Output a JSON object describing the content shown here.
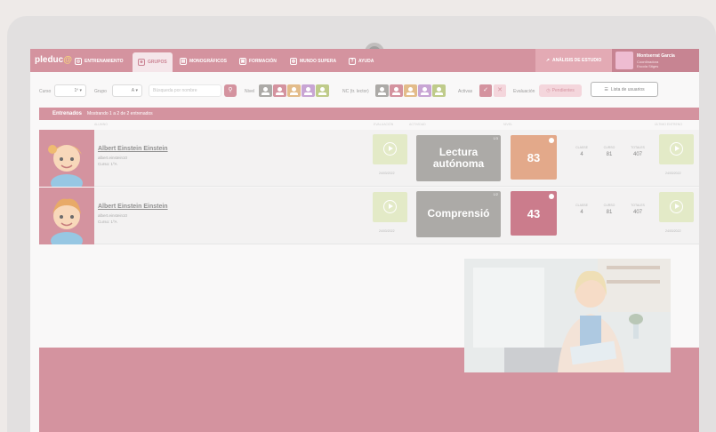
{
  "app": {
    "logo_text": "pleduc",
    "logo_dot": "@"
  },
  "nav": {
    "items": [
      {
        "label": "ENTRENAMIENTO"
      },
      {
        "label": "GRUPOS"
      },
      {
        "label": "MONOGRÁFICOS"
      },
      {
        "label": "FORMACIÓN"
      },
      {
        "label": "MUNDO SUPERA"
      },
      {
        "label": "AYUDA"
      }
    ],
    "active_index": 1,
    "analisis_label": "ANÁLISIS DE ESTUDIO"
  },
  "profile": {
    "name": "Montserrat García",
    "role": "Coordinadora",
    "school": "Escola Sitges"
  },
  "filters": {
    "curso_label": "Curso",
    "curso_value": "1º",
    "grupo_label": "Grupo",
    "grupo_value": "A",
    "search_placeholder": "Búsqueda por nombre",
    "nivel_label": "Nivel",
    "nc_label": "NC (tr. lector)",
    "activas_label": "Activas",
    "evaluacion_label": "Evaluación",
    "pendientes_label": "Pendientes",
    "lista_label": "Lista de usuarios"
  },
  "section": {
    "title": "Entrenados",
    "summary": "Mostrando 1 a 2 de 2 entrenados"
  },
  "col_headers": {
    "student": "ALUMNO",
    "eval": "EVALUACIÓN",
    "act": "ACTIVIDAD",
    "nc": "NIVEL",
    "last": "ÚLTIMO ENTRENO"
  },
  "students": [
    {
      "name": "Albert Einstein Einstein",
      "user": "albert.einstein10",
      "curso": "Curso: 1ºA",
      "eval_date": "24/03/2022",
      "activity": "Lectura autónoma",
      "activity_count": "1/3",
      "score": "83",
      "score_color": "#d9885e",
      "stats": [
        {
          "label": "CLASSE",
          "value": "4"
        },
        {
          "label": "CURSO",
          "value": "81"
        },
        {
          "label": "TOTALES",
          "value": "407"
        }
      ],
      "last_date": "24/03/2022"
    },
    {
      "name": "Albert Einstein Einstein",
      "user": "albert.einstein10",
      "curso": "Curso: 1ºA",
      "eval_date": "24/03/2022",
      "activity": "Comprensió",
      "activity_count": "1/2",
      "score": "43",
      "score_color": "#b84a60",
      "stats": [
        {
          "label": "CLASSE",
          "value": "4"
        },
        {
          "label": "CURSO",
          "value": "81"
        },
        {
          "label": "TOTALES",
          "value": "407"
        }
      ],
      "last_date": "24/03/2022"
    }
  ],
  "colors": {
    "brand": "#c46a7b",
    "nivel_chips": [
      "#8d8a85",
      "#c46a7b",
      "#d9a35e",
      "#b383c4",
      "#a7b85e"
    ],
    "nc_chips": [
      "#8d8a85",
      "#c46a7b",
      "#d9a35e",
      "#b383c4",
      "#a7b85e"
    ]
  }
}
